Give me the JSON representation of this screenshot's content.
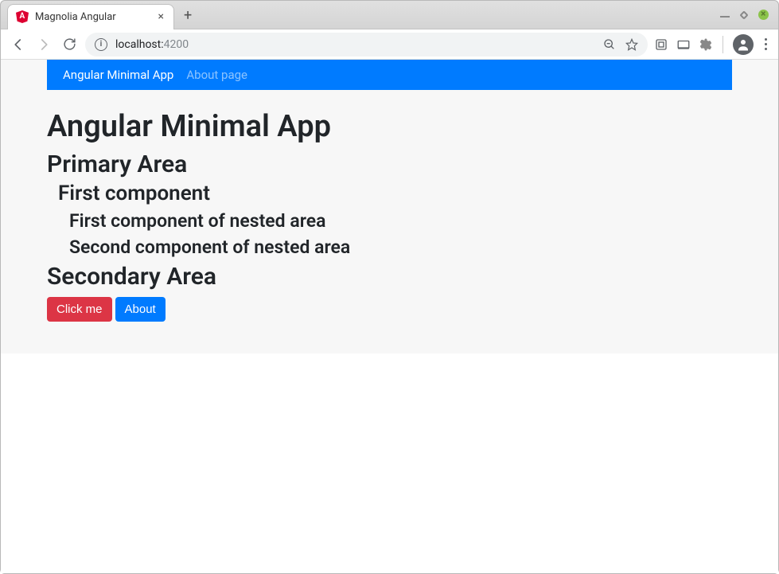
{
  "browser": {
    "tab_title": "Magnolia Angular",
    "url_host": "localhost:",
    "url_port": "4200"
  },
  "nav": {
    "items": [
      {
        "label": "Angular Minimal App",
        "active": true
      },
      {
        "label": "About page",
        "active": false
      }
    ]
  },
  "page": {
    "title": "Angular Minimal App",
    "primary_area": {
      "title": "Primary Area",
      "components": [
        {
          "title": "First component",
          "nested": [
            {
              "title": "First component of nested area"
            },
            {
              "title": "Second component of nested area"
            }
          ]
        }
      ]
    },
    "secondary_area": {
      "title": "Secondary Area",
      "buttons": [
        {
          "label": "Click me",
          "variant": "danger"
        },
        {
          "label": "About",
          "variant": "primary"
        }
      ]
    }
  },
  "colors": {
    "brand_blue": "#007bff",
    "brand_red": "#dc3545"
  }
}
